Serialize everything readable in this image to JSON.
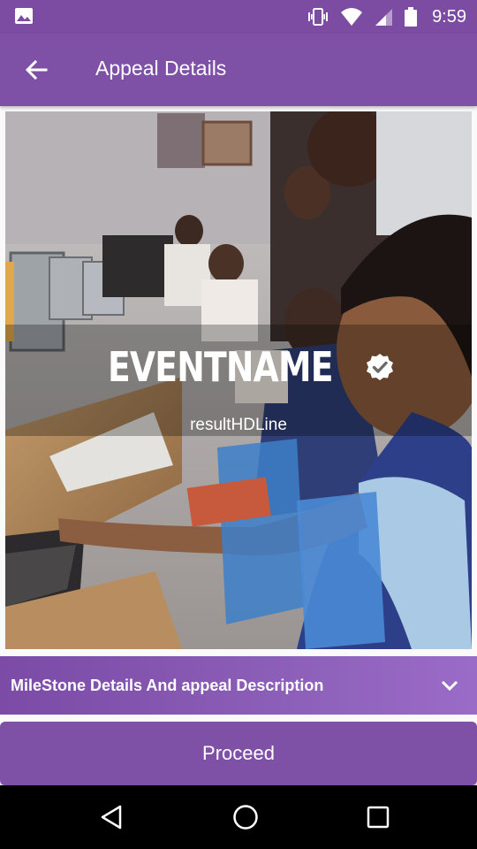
{
  "status_bar": {
    "time": "9:59",
    "icons": [
      "image-icon",
      "vibrate-icon",
      "wifi-icon",
      "signal-icon",
      "battery-icon"
    ]
  },
  "app_bar": {
    "title": "Appeal Details",
    "back_icon": "arrow-left-icon"
  },
  "hero": {
    "event_name": "EVENTNAME",
    "verified_icon": "verified-badge-icon",
    "subline": "resultHDLine"
  },
  "milestone": {
    "label": "MileStone Details And appeal Description",
    "icon": "chevron-down-icon"
  },
  "proceed": {
    "label": "Proceed"
  },
  "nav_bar": {
    "icons": [
      "back-triangle-icon",
      "home-circle-icon",
      "recents-square-icon"
    ]
  },
  "colors": {
    "primary": "#7e50a6",
    "status_bar": "#7c4ca3",
    "nav_bar": "#000000"
  }
}
